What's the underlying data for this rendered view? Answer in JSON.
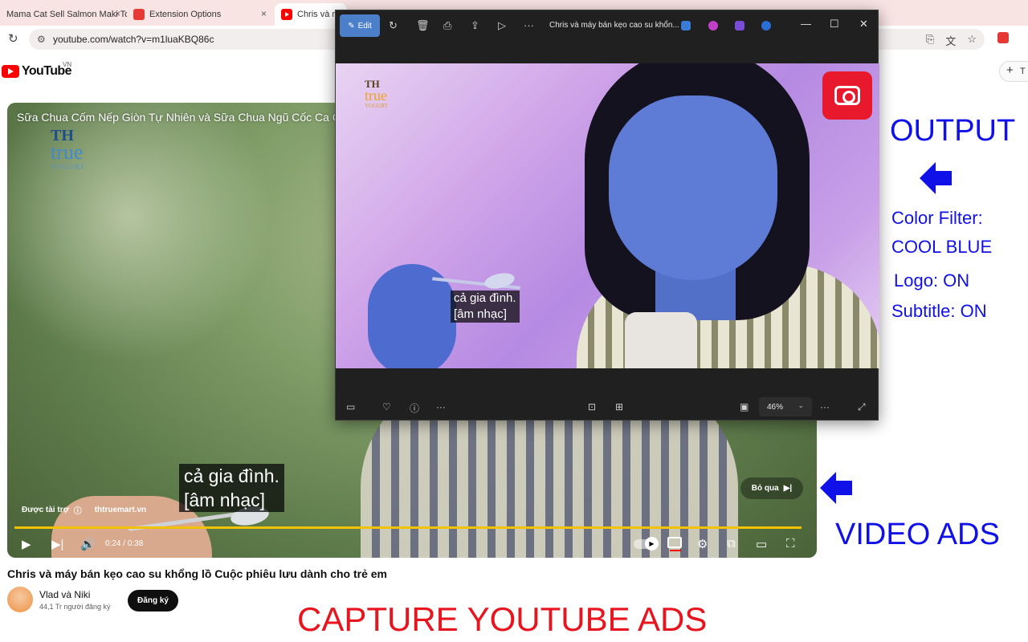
{
  "browser": {
    "tabs": [
      {
        "label": "Mama Cat Sell Salmon Maki To",
        "close": "×"
      },
      {
        "label": "Extension Options",
        "close": "×"
      },
      {
        "label": "Chris và máy",
        "close": "×"
      }
    ],
    "url": "youtube.com/watch?v=m1luaKBQ86c"
  },
  "youtube": {
    "logo_text": "YouTube",
    "country": "VN",
    "create_label": "T",
    "player": {
      "title": "Sữa Chua Cốm Nếp Giòn Tự Nhiên và Sữa Chua Ngũ Cốc Ca Cao",
      "brand_logo": {
        "th": "TH",
        "true": "true",
        "yogurt": "YOGURT"
      },
      "subtitle_lines": [
        "cả gia đình.",
        "[âm nhạc]"
      ],
      "sponsored_label": "Được tài trợ",
      "sponsor_site": "thtruemart.vn",
      "skip_label": "Bỏ qua",
      "time": "0:24 / 0:38",
      "progress": 0.99
    },
    "video_title": "Chris và máy bán kẹo cao su khổng lồ Cuộc phiêu lưu dành cho trẻ em",
    "channel_name": "Vlad và Niki",
    "subscriber_count": "44,1 Tr người đăng ký",
    "subscribe_label": "Đăng ký"
  },
  "photos_window": {
    "edit_label": "Edit",
    "title": "Chris và máy bán kẹo cao su khổn...",
    "logo": {
      "th": "TH",
      "true": "true",
      "yogurt": "YOGURT"
    },
    "subtitle_lines": [
      "cả gia đình.",
      "[âm nhạc]"
    ],
    "zoom": "46%"
  },
  "annotations": {
    "output": "OUTPUT",
    "filter_label": "Color Filter:",
    "filter_value": "COOL BLUE",
    "logo": "Logo: ON",
    "subtitle": "Subtitle: ON",
    "video_ads": "VIDEO ADS",
    "capture": "CAPTURE YOUTUBE ADS"
  },
  "colors": {
    "annotation_blue": "#1010e8",
    "annotation_red": "#e8141e",
    "youtube_red": "#ff0000",
    "progress_yellow": "#f2c200",
    "photos_accent": "#4b7fc9"
  }
}
